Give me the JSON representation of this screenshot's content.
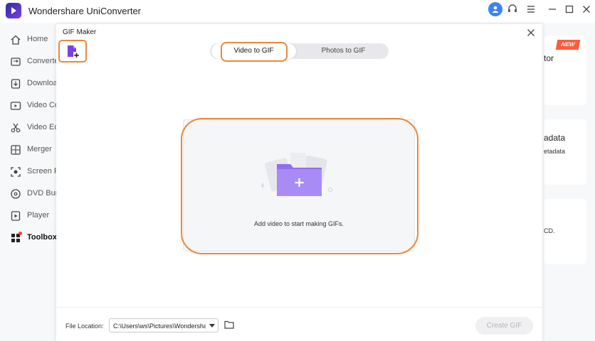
{
  "app": {
    "title": "Wondershare UniConverter"
  },
  "window_controls": [
    "user-icon",
    "support-icon",
    "menu-icon",
    "minimize-icon",
    "maximize-icon",
    "close-icon"
  ],
  "sidebar": {
    "items": [
      {
        "label": "Home",
        "icon": "home-icon"
      },
      {
        "label": "Converte",
        "icon": "converter-icon"
      },
      {
        "label": "Downloa",
        "icon": "download-icon"
      },
      {
        "label": "Video Co",
        "icon": "video-compressor-icon"
      },
      {
        "label": "Video Ed",
        "icon": "video-editor-icon"
      },
      {
        "label": "Merger",
        "icon": "merger-icon"
      },
      {
        "label": "Screen R",
        "icon": "screen-recorder-icon"
      },
      {
        "label": "DVD Bur",
        "icon": "dvd-burner-icon"
      },
      {
        "label": "Player",
        "icon": "player-icon"
      },
      {
        "label": "Toolbox",
        "icon": "toolbox-icon",
        "active": true
      }
    ]
  },
  "background_cards": {
    "card1_text": "tor",
    "new_badge": "NEW",
    "card2_title": "adata",
    "card2_sub": "etadata",
    "card3_text": "CD."
  },
  "dialog": {
    "title": "GIF Maker",
    "tabs": [
      {
        "label": "Video to GIF",
        "selected": true
      },
      {
        "label": "Photos to GIF",
        "selected": false
      }
    ],
    "drop_text": "Add video to start making GIFs.",
    "file_location_label": "File Location:",
    "file_location_value": "C:\\Users\\ws\\Pictures\\Wondershare UniConverter",
    "create_button": "Create GIF"
  },
  "colors": {
    "highlight": "#e9893c",
    "folder": "#9b7cf2",
    "accent": "#7b3fe4",
    "badge": "#ff5a3d"
  }
}
